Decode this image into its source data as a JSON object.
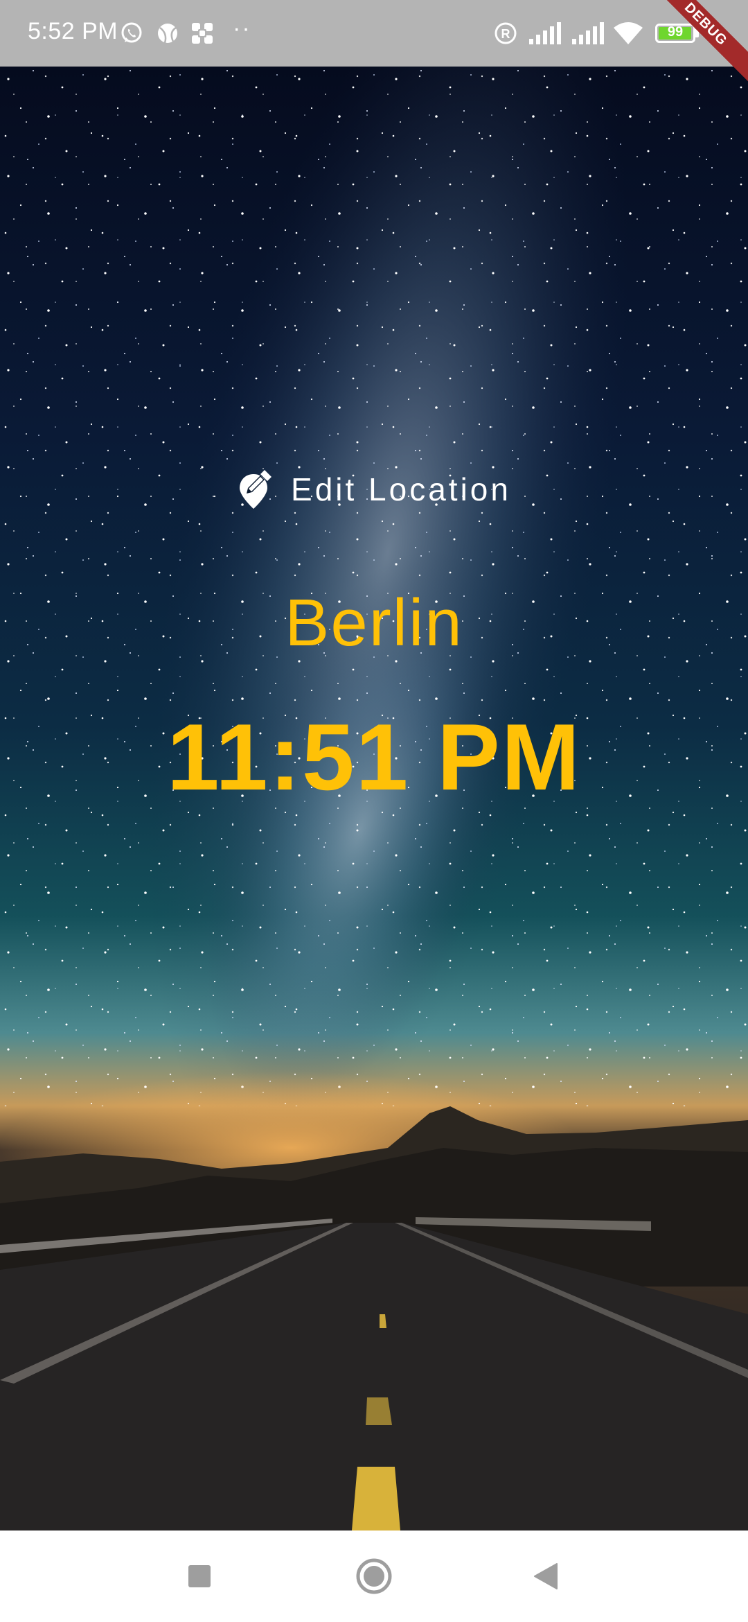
{
  "status_bar": {
    "time": "5:52 PM",
    "left_icons": [
      "whatsapp-icon",
      "ball-icon",
      "app-grid-icon"
    ],
    "more_indicator": "··",
    "right_icons": [
      "registered-icon",
      "signal-icon",
      "signal-icon",
      "wifi-icon",
      "battery-icon",
      "charging-icon"
    ],
    "battery_level": "99",
    "battery_fraction": 0.99
  },
  "debug_banner": {
    "label": "DEBUG"
  },
  "background": {
    "description_icon": "night-sky-road-image"
  },
  "location": {
    "edit_label": "Edit Location",
    "edit_icon": "edit-location-icon",
    "city": "Berlin",
    "time": "11:51 PM"
  },
  "nav_bar": {
    "buttons": [
      "recents-square-icon",
      "home-circle-icon",
      "back-triangle-icon"
    ]
  },
  "colors": {
    "status_bar_bg": "#b4b4b4",
    "accent_amber": "#ffc107",
    "text_white": "#ffffff",
    "nav_icon_gray": "#9e9e9e",
    "debug_red": "#a32a2a",
    "battery_green": "#6fd62e"
  }
}
